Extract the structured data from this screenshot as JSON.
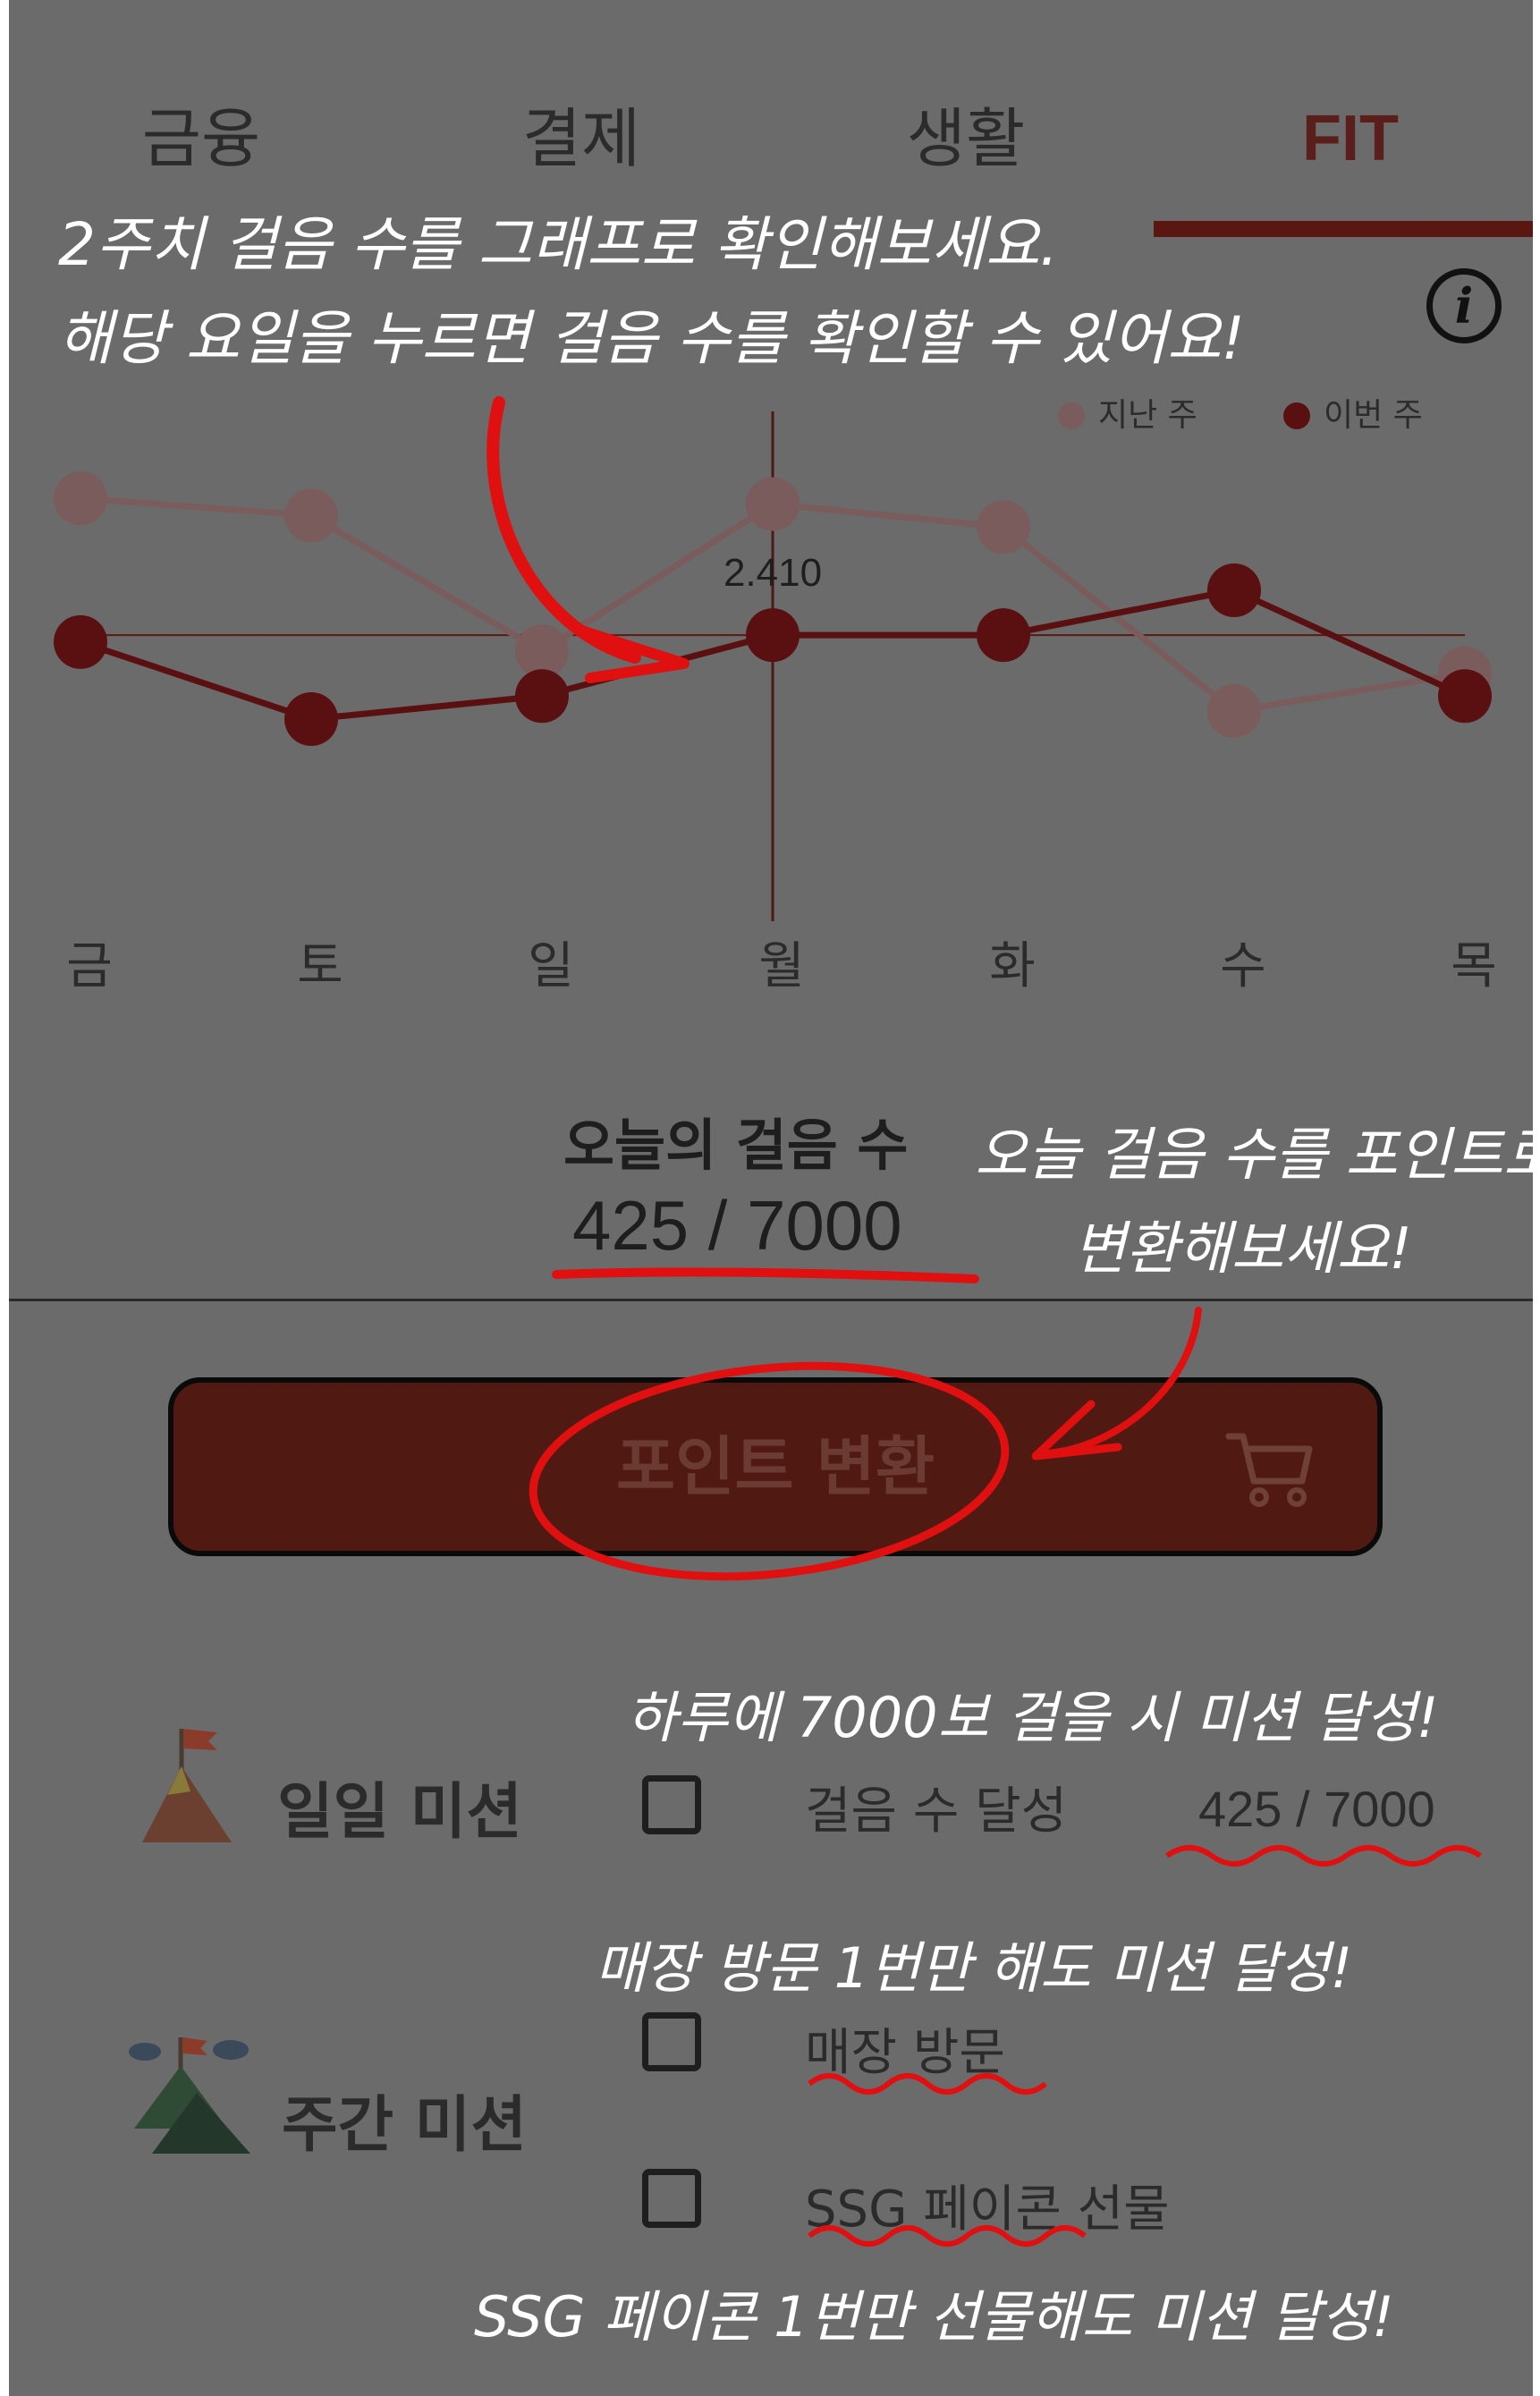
{
  "tabs": [
    {
      "label": "금융",
      "active": false
    },
    {
      "label": "결제",
      "active": false
    },
    {
      "label": "생활",
      "active": false
    },
    {
      "label": "FIT",
      "active": true
    }
  ],
  "info_icon_label": "i",
  "annotations": {
    "chart_note_line1": "2주치 걸음 수를 그래프로 확인해보세요.",
    "chart_note_line2": "해당 요일을 누르면 걸음 수를 확인할 수 있어요!",
    "steps_note_line1": "오늘 걸음 수를 포인트로",
    "steps_note_line2": "변환해보세요!",
    "daily_note": "하루에 7000보 걸을 시 미션 달성!",
    "visit_note": "매장 방문 1번만 해도 미션 달성!",
    "gift_note": "SSG 페이콘 1번만 선물해도 미션 달성!"
  },
  "chart_data": {
    "type": "line",
    "categories": [
      "금",
      "토",
      "일",
      "월",
      "화",
      "수",
      "목"
    ],
    "series": [
      {
        "name": "지난 주",
        "color": "#7a5c5c",
        "values": [
          3600,
          3450,
          2270,
          3550,
          3350,
          1750,
          2080
        ]
      },
      {
        "name": "이번 주",
        "color": "#5a1010",
        "values": [
          2350,
          1680,
          1880,
          2410,
          2410,
          2800,
          1880
        ]
      }
    ],
    "selected_index": 3,
    "selected_value_label": "2.410",
    "reference_value": 2410,
    "legend_position": "top-right",
    "ylim": [
      0,
      4200
    ],
    "grid": false
  },
  "steps": {
    "title": "오늘의 걸음 수",
    "count": "425 / 7000"
  },
  "convert_button": {
    "label": "포인트 변환",
    "icon": "cart-icon"
  },
  "daily_mission": {
    "title": "일일 미션",
    "icon": "mountain-flag-icon",
    "items": [
      {
        "label": "걸음 수 달성",
        "progress": "425 / 7000",
        "checked": false
      }
    ]
  },
  "weekly_mission": {
    "title": "주간 미션",
    "icon": "mountains-flag-icon",
    "items": [
      {
        "label": "매장 방문",
        "checked": false
      },
      {
        "label": "SSG 페이콘 선물",
        "checked": false
      }
    ]
  }
}
